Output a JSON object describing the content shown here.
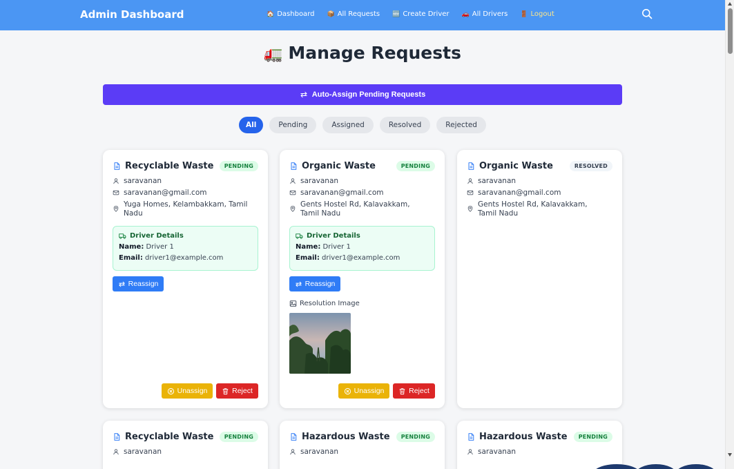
{
  "nav": {
    "brand": "Admin Dashboard",
    "links": [
      {
        "label": "Dashboard",
        "icon": "🏠"
      },
      {
        "label": "All Requests",
        "icon": "📦"
      },
      {
        "label": "Create Driver",
        "icon": "🆕"
      },
      {
        "label": "All Drivers",
        "icon": "🚗"
      },
      {
        "label": "Logout",
        "icon": "🚪"
      }
    ]
  },
  "page": {
    "title": "Manage Requests",
    "title_icon": "🚛",
    "auto_assign_label": "Auto-Assign Pending Requests"
  },
  "filters": [
    "All",
    "Pending",
    "Assigned",
    "Resolved",
    "Rejected"
  ],
  "active_filter": "All",
  "cards": [
    {
      "title": "Recyclable Waste",
      "status": "PENDING",
      "user": "saravanan",
      "email": "saravanan@gmail.com",
      "address": "Yuga Homes, Kelambakkam, Tamil Nadu",
      "driver": {
        "heading": "Driver Details",
        "name_label": "Name:",
        "name": "Driver 1",
        "email_label": "Email:",
        "email": "driver1@example.com"
      },
      "reassign_label": "Reassign",
      "unassign_label": "Unassign",
      "reject_label": "Reject"
    },
    {
      "title": "Organic Waste",
      "status": "PENDING",
      "user": "saravanan",
      "email": "saravanan@gmail.com",
      "address": "Gents Hostel Rd, Kalavakkam, Tamil Nadu",
      "driver": {
        "heading": "Driver Details",
        "name_label": "Name:",
        "name": "Driver 1",
        "email_label": "Email:",
        "email": "driver1@example.com"
      },
      "reassign_label": "Reassign",
      "resolution_label": "Resolution Image",
      "unassign_label": "Unassign",
      "reject_label": "Reject"
    },
    {
      "title": "Organic Waste",
      "status": "RESOLVED",
      "user": "saravanan",
      "email": "saravanan@gmail.com",
      "address": "Gents Hostel Rd, Kalavakkam, Tamil Nadu"
    },
    {
      "title": "Recyclable Waste",
      "status": "PENDING",
      "user": "saravanan"
    },
    {
      "title": "Hazardous Waste",
      "status": "PENDING",
      "user": "saravanan"
    },
    {
      "title": "Hazardous Waste",
      "status": "PENDING",
      "user": "saravanan"
    }
  ],
  "colors": {
    "navbar": "#4b96f3",
    "primary_button": "#5b3cf6",
    "filter_active": "#2563eb",
    "pending_badge": "#dcfce7",
    "reassign": "#2f7cf6",
    "unassign": "#eab308",
    "reject": "#dc2626"
  }
}
